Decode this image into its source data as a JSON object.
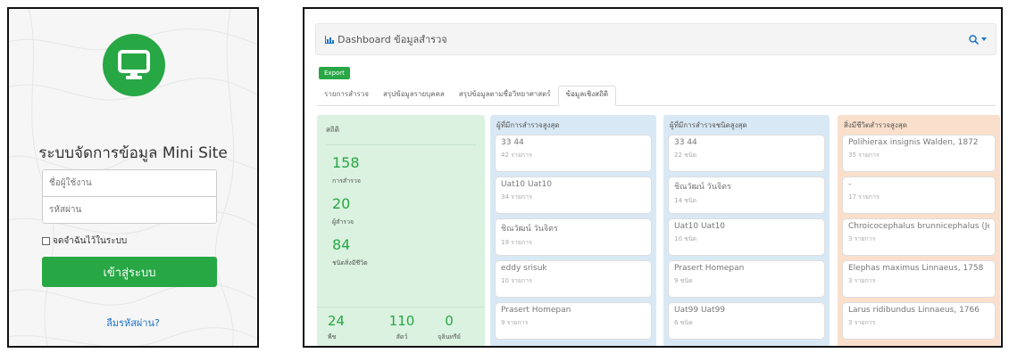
{
  "login": {
    "title": "ระบบจัดการข้อมูล Mini Site",
    "username_placeholder": "ชื่อผู้ใช้งาน",
    "password_placeholder": "รหัสผ่าน",
    "remember_label": "จดจำฉันไว้ในระบบ",
    "login_button": "เข้าสู่ระบบ",
    "forgot_link": "ลืมรหัสผ่าน?",
    "accent_color": "#28a745"
  },
  "dashboard": {
    "title": "Dashboard ข้อมูลสำรวจ",
    "title_icon": "bar-chart-icon",
    "search_icon": "search-icon",
    "export_label": "Export",
    "tabs": [
      {
        "label": "รายการสำรวจ",
        "active": false
      },
      {
        "label": "สรุปข้อมูลรายบุคคล",
        "active": false
      },
      {
        "label": "สรุปข้อมูลตามชื่อวิทยาศาสตร์",
        "active": false
      },
      {
        "label": "ข้อมูลเชิงสถิติ",
        "active": true
      }
    ],
    "stats": {
      "heading": "สถิติ",
      "items": [
        {
          "value": "158",
          "label": "การสำรวจ"
        },
        {
          "value": "20",
          "label": "ผู้สำรวจ"
        },
        {
          "value": "84",
          "label": "ชนิดสิ่งมีชีวิต"
        }
      ],
      "bottom": [
        {
          "value": "24",
          "label": "พืช"
        },
        {
          "value": "110",
          "label": "สัตว์"
        },
        {
          "value": "0",
          "label": "จุลินทรีย์"
        }
      ]
    },
    "top_surveyors": {
      "heading": "ผู้ที่มีการสำรวจสูงสุด",
      "cards": [
        {
          "name": "33 44",
          "sub": "42 รายการ"
        },
        {
          "name": "Uat10 Uat10",
          "sub": "34 รายการ"
        },
        {
          "name": "ชิณวัฒน์ วันจิตร",
          "sub": "19 รายการ"
        },
        {
          "name": "eddy srisuk",
          "sub": "10 รายการ"
        },
        {
          "name": "Prasert Homepan",
          "sub": "9 รายการ"
        }
      ]
    },
    "top_species_surveyors": {
      "heading": "ผู้ที่มีการสำรวจชนิดสูงสุด",
      "cards": [
        {
          "name": "33 44",
          "sub": "22 ชนิด"
        },
        {
          "name": "ชิณวัฒน์ วันจิตร",
          "sub": "14 ชนิด"
        },
        {
          "name": "Uat10 Uat10",
          "sub": "10 ชนิด"
        },
        {
          "name": "Prasert Homepan",
          "sub": "9 ชนิด"
        },
        {
          "name": "Uat99 Uat99",
          "sub": "6 ชนิด"
        }
      ]
    },
    "top_organisms": {
      "heading": "สิ่งมีชีวิตสำรวจสูงสุด",
      "cards": [
        {
          "name": "Polihierax insignis Walden, 1872",
          "sub": "35 รายการ"
        },
        {
          "name": "-",
          "sub": "17 รายการ"
        },
        {
          "name": "Chroicocephalus brunnicephalus (Jerdon",
          "sub": "3 รายการ"
        },
        {
          "name": "Elephas maximus Linnaeus, 1758",
          "sub": "3 รายการ"
        },
        {
          "name": "Larus ridibundus Linnaeus, 1766",
          "sub": "3 รายการ"
        }
      ]
    }
  }
}
